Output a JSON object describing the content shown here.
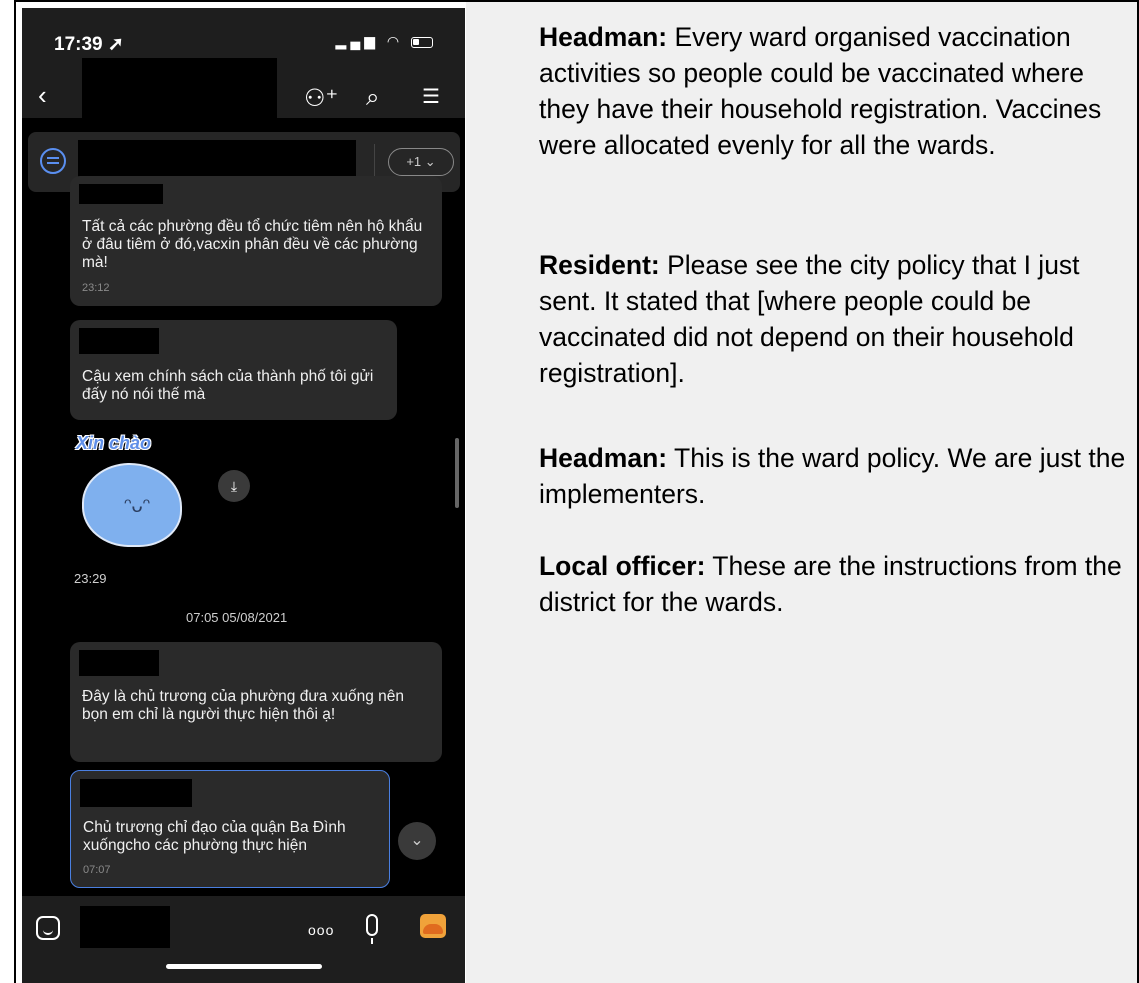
{
  "phone": {
    "status": {
      "time": "17:39 ➚"
    },
    "pinned": {
      "more_label": "+1 ⌄"
    },
    "messages": [
      {
        "text": "Tất cả các phường đều tổ chức tiêm nên hộ khẩu ở đâu tiêm ở đó,vacxin phân đều về các phường mà!",
        "time": "23:12"
      },
      {
        "text": "Cậu xem chính sách của thành phố tôi gửi đấy nó nói thế mà",
        "time": ""
      },
      {
        "text": "Đây là chủ trương của phường đưa xuống nên bọn em chỉ là người thực hiện thôi ạ!",
        "time": ""
      },
      {
        "text": "Chủ trương chỉ đạo của quận Ba Đình xuốngcho các phường thực  hiện",
        "time": "07:07"
      }
    ],
    "sticker": {
      "text": "Xin chào",
      "time": "23:29"
    },
    "date_separator": "07:05 05/08/2021"
  },
  "translation": [
    {
      "speaker": "Headman:",
      "text": " Every ward organised vaccination activities so people could be vaccinated where they have their household registration. Vaccines were allocated evenly for all the wards."
    },
    {
      "speaker": "Resident:",
      "text": " Please see the city policy that I just sent. It stated that [where people could be vaccinated did not depend on their household registration]."
    },
    {
      "speaker": "Headman:",
      "text": " This is the ward policy. We are just the implementers."
    },
    {
      "speaker": "Local officer:",
      "text": " These are the instructions from the district for the wards."
    }
  ],
  "colors": {
    "accent": "#4a7fe0",
    "bubble": "#2a2a2a",
    "panel_bg": "#f0f0f0"
  }
}
